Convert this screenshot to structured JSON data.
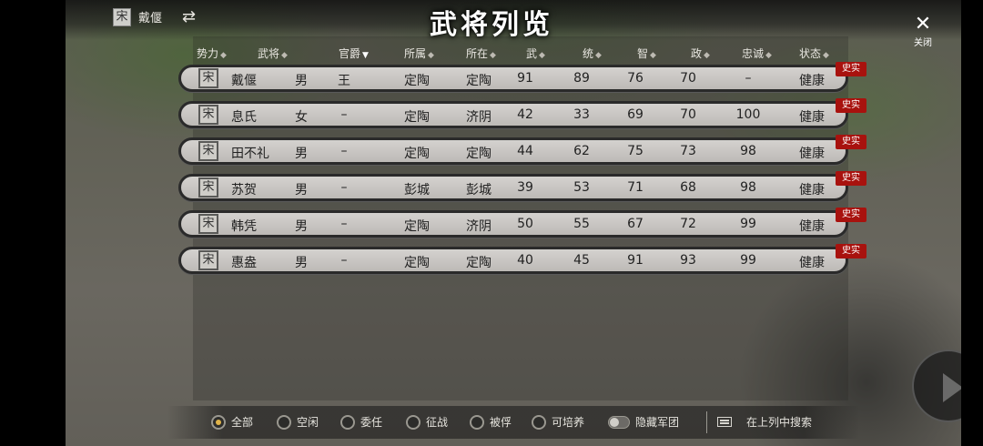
{
  "window": {
    "title": "武将列览",
    "close_label": "关闭",
    "close_icon": "close-icon",
    "swap_icon": "swap-icon"
  },
  "faction": {
    "seal": "宋",
    "name": "戴偃"
  },
  "columns": [
    {
      "key": "faction",
      "label": "势力",
      "sort": "none"
    },
    {
      "key": "name",
      "label": "武将",
      "sort": "none"
    },
    {
      "key": "gender",
      "label": "",
      "sort": "none"
    },
    {
      "key": "rank",
      "label": "官爵",
      "sort": "desc"
    },
    {
      "key": "belong",
      "label": "所属",
      "sort": "none"
    },
    {
      "key": "location",
      "label": "所在",
      "sort": "none"
    },
    {
      "key": "war",
      "label": "武",
      "sort": "none"
    },
    {
      "key": "lead",
      "label": "统",
      "sort": "none"
    },
    {
      "key": "intel",
      "label": "智",
      "sort": "none"
    },
    {
      "key": "politics",
      "label": "政",
      "sort": "none"
    },
    {
      "key": "loyalty",
      "label": "忠诚",
      "sort": "none"
    },
    {
      "key": "status",
      "label": "状态",
      "sort": "none"
    }
  ],
  "officers": [
    {
      "seal": "宋",
      "name": "戴偃",
      "gender": "男",
      "rank": "王",
      "belong": "定陶",
      "location": "定陶",
      "war": "91",
      "lead": "89",
      "intel": "76",
      "politics": "70",
      "loyalty": "–",
      "status": "健康",
      "badge": "史实"
    },
    {
      "seal": "宋",
      "name": "息氏",
      "gender": "女",
      "rank": "–",
      "belong": "定陶",
      "location": "济阴",
      "war": "42",
      "lead": "33",
      "intel": "69",
      "politics": "70",
      "loyalty": "100",
      "status": "健康",
      "badge": "史实"
    },
    {
      "seal": "宋",
      "name": "田不礼",
      "gender": "男",
      "rank": "–",
      "belong": "定陶",
      "location": "定陶",
      "war": "44",
      "lead": "62",
      "intel": "75",
      "politics": "73",
      "loyalty": "98",
      "status": "健康",
      "badge": "史实"
    },
    {
      "seal": "宋",
      "name": "苏贺",
      "gender": "男",
      "rank": "–",
      "belong": "彭城",
      "location": "彭城",
      "war": "39",
      "lead": "53",
      "intel": "71",
      "politics": "68",
      "loyalty": "98",
      "status": "健康",
      "badge": "史实"
    },
    {
      "seal": "宋",
      "name": "韩凭",
      "gender": "男",
      "rank": "–",
      "belong": "定陶",
      "location": "济阴",
      "war": "50",
      "lead": "55",
      "intel": "67",
      "politics": "72",
      "loyalty": "99",
      "status": "健康",
      "badge": "史实"
    },
    {
      "seal": "宋",
      "name": "惠盎",
      "gender": "男",
      "rank": "–",
      "belong": "定陶",
      "location": "定陶",
      "war": "40",
      "lead": "45",
      "intel": "91",
      "politics": "93",
      "loyalty": "99",
      "status": "健康",
      "badge": "史实"
    }
  ],
  "filters": [
    {
      "label": "全部",
      "selected": true
    },
    {
      "label": "空闲",
      "selected": false
    },
    {
      "label": "委任",
      "selected": false
    },
    {
      "label": "征战",
      "selected": false
    },
    {
      "label": "被俘",
      "selected": false
    },
    {
      "label": "可培养",
      "selected": false
    }
  ],
  "hide_legion": {
    "label": "隐藏军团",
    "on": false
  },
  "search": {
    "label": "在上列中搜索",
    "icon": "keyboard-icon"
  },
  "colors": {
    "badge": "#a8120e",
    "pill": "#c9c7c3",
    "pill_border": "#2a2a2a",
    "radio_dot": "#e0b44a"
  }
}
